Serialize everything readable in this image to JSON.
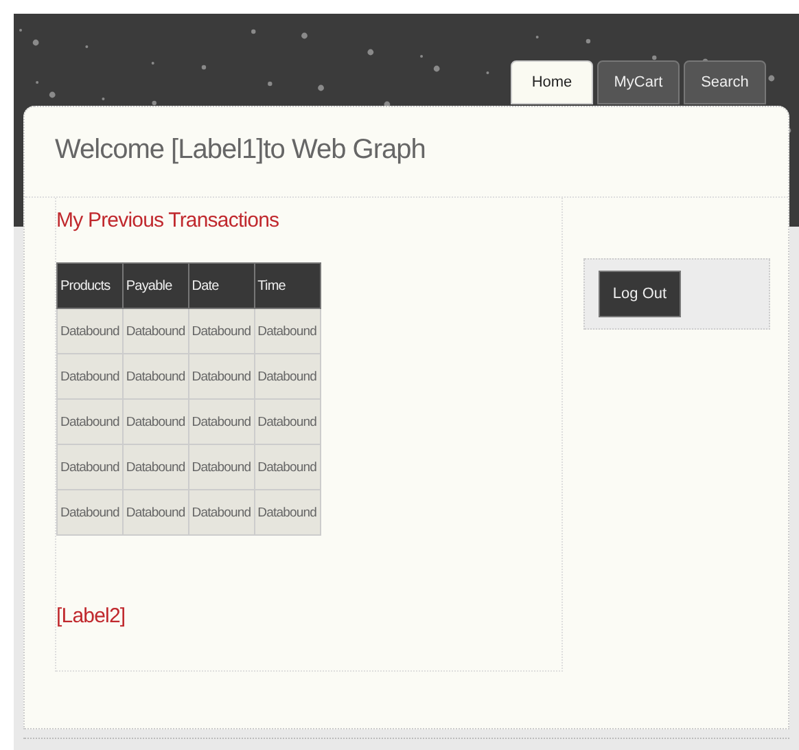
{
  "tabs": [
    {
      "label": "Home",
      "selected": true
    },
    {
      "label": "MyCart",
      "selected": false
    },
    {
      "label": "Search",
      "selected": false
    }
  ],
  "welcome": "Welcome [Label1]to Web Graph",
  "section_title": "My Previous Transactions",
  "table": {
    "columns": [
      "Products",
      "Payable",
      "Date",
      "Time"
    ],
    "rows": [
      [
        "Databound",
        "Databound",
        "Databound",
        "Databound"
      ],
      [
        "Databound",
        "Databound",
        "Databound",
        "Databound"
      ],
      [
        "Databound",
        "Databound",
        "Databound",
        "Databound"
      ],
      [
        "Databound",
        "Databound",
        "Databound",
        "Databound"
      ],
      [
        "Databound",
        "Databound",
        "Databound",
        "Databound"
      ]
    ]
  },
  "label2": "[Label2]",
  "logout_button": "Log Out"
}
